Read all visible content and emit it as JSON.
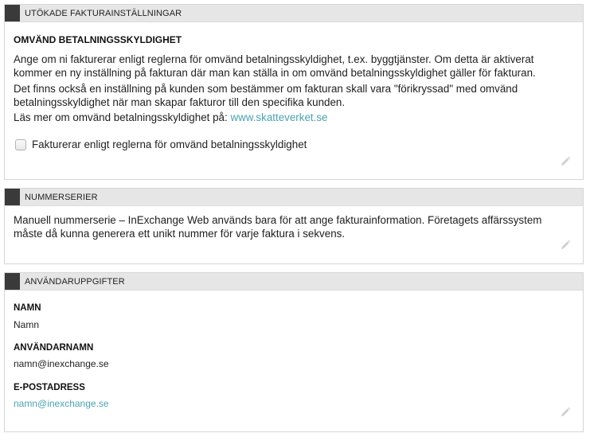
{
  "invoice_settings": {
    "header": "UTÖKADE FAKTURAINSTÄLLNINGAR",
    "subtitle": "OMVÄND BETALNINGSSKYLDIGHET",
    "paragraph1": "Ange om ni fakturerar enligt reglerna för omvänd betalningsskyldighet, t.ex. byggtjänster. Om detta är aktiverat kommer en ny inställning på fakturan där man kan ställa in om omvänd betalningsskyldighet gäller för fakturan.",
    "paragraph2": "Det finns också en inställning på kunden som bestämmer om fakturan skall vara \"förikryssad\" med omvänd betalningsskyldighet när man skapar fakturor till den specifika kunden.",
    "read_more_text": "Läs mer om omvänd betalningsskyldighet på:",
    "read_more_link": "www.skatteverket.se",
    "checkbox_label": "Fakturerar enligt reglerna för omvänd betalningsskyldighet",
    "checkbox_checked": false
  },
  "number_series": {
    "header": "NUMMERSERIER",
    "text": "Manuell nummerserie – InExchange Web används bara för att ange fakturainformation. Företagets affärssystem måste då kunna generera ett unikt nummer för varje faktura i sekvens."
  },
  "user_info": {
    "header": "ANVÄNDARUPPGIFTER",
    "name_label": "NAMN",
    "name_value": "Namn",
    "username_label": "ANVÄNDARNAMN",
    "username_value": "namn@inexchange.se",
    "email_label": "E-POSTADRESS",
    "email_value": "namn@inexchange.se"
  },
  "icons": {
    "edit": "pencil-icon"
  },
  "colors": {
    "header_bg": "#e6e6e6",
    "marker": "#3a3a3a",
    "link": "#4aa3b2"
  }
}
